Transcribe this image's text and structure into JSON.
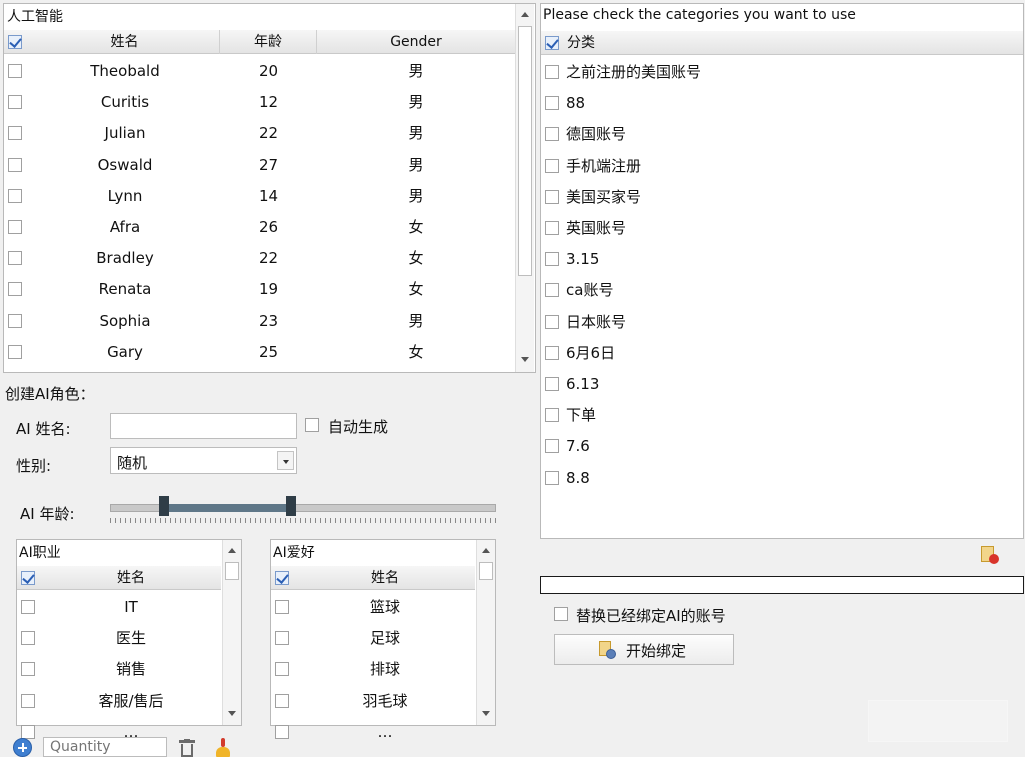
{
  "people": {
    "title": "人工智能",
    "columns": [
      "姓名",
      "年龄",
      "Gender"
    ],
    "rows": [
      {
        "name": "Theobald",
        "age": "20",
        "gender": "男"
      },
      {
        "name": "Curitis",
        "age": "12",
        "gender": "男"
      },
      {
        "name": "Julian",
        "age": "22",
        "gender": "男"
      },
      {
        "name": "Oswald",
        "age": "27",
        "gender": "男"
      },
      {
        "name": "Lynn",
        "age": "14",
        "gender": "男"
      },
      {
        "name": "Afra",
        "age": "26",
        "gender": "女"
      },
      {
        "name": "Bradley",
        "age": "22",
        "gender": "女"
      },
      {
        "name": "Renata",
        "age": "19",
        "gender": "女"
      },
      {
        "name": "Sophia",
        "age": "23",
        "gender": "男"
      },
      {
        "name": "Gary",
        "age": "25",
        "gender": "女"
      }
    ]
  },
  "create": {
    "section_title": "创建AI角色：",
    "name_label": "AI 姓名:",
    "name_value": "",
    "auto_label": "自动生成",
    "gender_label": "性别:",
    "gender_value": "随机",
    "age_label": "AI 年龄:",
    "age_range_fraction": [
      0.14,
      0.47
    ]
  },
  "job": {
    "title": "AI职业",
    "column": "姓名",
    "items": [
      "IT",
      "医生",
      "销售",
      "客服/售后",
      "…"
    ]
  },
  "hobby": {
    "title": "AI爱好",
    "column": "姓名",
    "items": [
      "篮球",
      "足球",
      "排球",
      "羽毛球",
      "…"
    ]
  },
  "toolbar": {
    "quantity_placeholder": "Quantity"
  },
  "categories": {
    "title": "Please check the categories you want to use",
    "column": "分类",
    "items": [
      "之前注册的美国账号",
      "88",
      "德国账号",
      "手机端注册",
      "美国买家号",
      "英国账号",
      "3.15",
      "ca账号",
      "日本账号",
      "6月6日",
      "6.13",
      "下单",
      "7.6",
      "8.8"
    ]
  },
  "bind": {
    "progress_value": "",
    "replace_label": "替换已经绑定AI的账号",
    "start_label": "开始绑定"
  },
  "colors": {
    "accent": "#2b5fb5",
    "slider_fill": "#5f7788"
  }
}
